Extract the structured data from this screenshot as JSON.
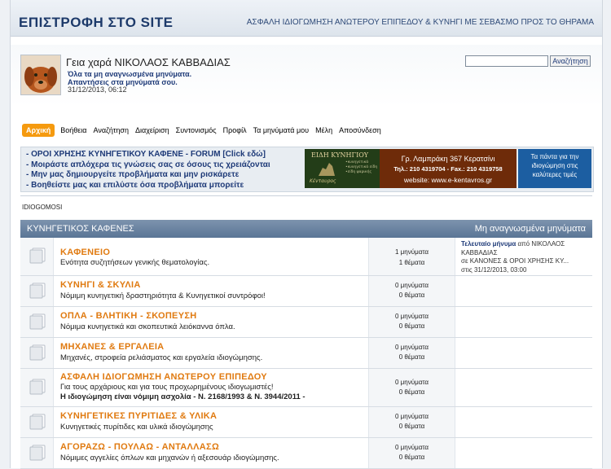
{
  "header": {
    "site_title": "ΕΠΙΣΤΡΟΦΗ ΣΤΟ SITE",
    "tagline": "ΑΣΦΑΛΗ ΙΔΙΟΓΩΜΗΣΗ ΑΝΩΤΕΡΟΥ ΕΠΙΠΕΔΟΥ & ΚΥΝΗΓΙ ΜΕ ΣΕΒΑΣΜΟ ΠΡΟΣ ΤΟ ΘΗΡΑΜΑ"
  },
  "user": {
    "greeting": "Γεια χαρά ΝΙΚΟΛΑΟΣ ΚΑΒΒΑΔΙΑΣ",
    "unread_link": "Όλα τα μη αναγνωσμένα μηνύματα.",
    "replies_link": "Απαντήσεις στα μηνύματά σου.",
    "datetime": "31/12/2013, 06:12"
  },
  "search": {
    "value": "",
    "button": "Αναζήτηση"
  },
  "nav": [
    "Αρχική",
    "Βοήθεια",
    "Αναζήτηση",
    "Διαχείριση",
    "Συντονισμός",
    "Προφίλ",
    "Τα μηνύματά μου",
    "Μέλη",
    "Αποσύνδεση"
  ],
  "banner": {
    "rules": [
      "- ΟΡΟΙ ΧΡΗΣΗΣ ΚΥΝΗΓΕΤΙΚΟΥ ΚΑΦΕΝΕ - FORUM [Click εδώ]",
      "- Μοιράστε απλόχερα τις γνώσεις σας σε όσους τις χρειάζονται",
      "- Μην μας δημιουργείτε προβλήματα και μην ρισκάρετε",
      "- Βοηθείστε μας και επιλύστε όσα προβλήματα μπορείτε"
    ],
    "ad1_title": "ΕΙΔΗ ΚΥΝΗΓΙΟΥ",
    "ad1_sub": [
      "•κυνηγετικά",
      "•κυνηγετικά είδη",
      "•είδη ψαρικής"
    ],
    "ad1_brand": "Κένταυρος",
    "ad2_lines": [
      "Γρ. Λαμπράκη 367 Κερατσίνι",
      "Τηλ.: 210 4319704 - Fax.: 210 4319758",
      "website: www.e-kentavros.gr"
    ],
    "ad3_lines": [
      "Τα πάντα για την",
      "ιδιογώμηση στις",
      "καλύτερες τιμές"
    ]
  },
  "breadcrumb": "IDIOGOMOSI",
  "table": {
    "category": "ΚΥΝΗΓΕΤΙΚΟΣ ΚΑΦΕΝΕΣ",
    "unread": "Μη αναγνωσμένα μηνύματα",
    "forums": [
      {
        "name": "ΚΑΦΕΝΕΙΟ",
        "desc": [
          "Ενότητα συζητήσεων γενικής θεματολογίας."
        ],
        "posts": "1 μηνύματα",
        "topics": "1 θέματα",
        "last": {
          "label": "Τελευταίο μήνυμα",
          "by": " από ΝΙΚΟΛΑΟΣ",
          "by2": "ΚΑΒΒΑΔΙΑΣ",
          "in": "σε ΚΑΝΟΝΕΣ & ΟΡΟΙ ΧΡΗΣΗΣ ΚΥ...",
          "on": "στις 31/12/2013, 03:00"
        }
      },
      {
        "name": "ΚΥΝΗΓΙ & ΣΚΥΛΙΑ",
        "desc": [
          "Νόμιμη κυνηγετική δραστηριότητα & Κυνηγετικοί συντρόφοι!"
        ],
        "posts": "0 μηνύματα",
        "topics": "0 θέματα"
      },
      {
        "name": "ΟΠΛΑ - ΒΛΗΤΙΚΗ - ΣΚΟΠΕΥΣΗ",
        "desc": [
          "Νόμιμα κυνηγετικά και σκοπευτικά λειόκαννα όπλα."
        ],
        "posts": "0 μηνύματα",
        "topics": "0 θέματα"
      },
      {
        "name": "ΜΗΧΑΝΕΣ & ΕΡΓΑΛΕΙΑ",
        "desc": [
          "Μηχανές, στροφεία ρελιάσματος και εργαλεία ιδιογώμησης."
        ],
        "posts": "0 μηνύματα",
        "topics": "0 θέματα"
      },
      {
        "name": "ΑΣΦΑΛΗ ΙΔΙΟΓΩΜΗΣΗ ΑΝΩΤΕΡΟΥ ΕΠΙΠΕΔΟΥ",
        "desc": [
          "Για τους αρχάριους και για τους προχωρημένους ιδιογωμιστές!"
        ],
        "desc_bold": "Η ιδιογώμηση είναι νόμιμη ασχολία - Ν. 2168/1993 & Ν. 3944/2011 -",
        "posts": "0 μηνύματα",
        "topics": "0 θέματα"
      },
      {
        "name": "ΚΥΝΗΓΕΤΙΚΕΣ ΠΥΡΙΤΙΔΕΣ & ΥΛΙΚΑ",
        "desc": [
          "Κυνηγετικές πυρίτιδες και υλικά ιδιογώμησης"
        ],
        "posts": "0 μηνύματα",
        "topics": "0 θέματα"
      },
      {
        "name": "ΑΓΟΡΑΖΩ - ΠΟΥΛΑΩ - ΑΝΤΑΛΛΑΣΩ",
        "desc": [
          "Νόμιμες αγγελίες όπλων και μηχανών ή αξεσουάρ ιδιογώμησης."
        ],
        "posts": "0 μηνύματα",
        "topics": "0 θέματα"
      }
    ]
  },
  "colors": {
    "accent": "#f59a0f",
    "header_bar": "#5a7595",
    "forum_name": "#e07a10",
    "link": "#1e3a78"
  }
}
